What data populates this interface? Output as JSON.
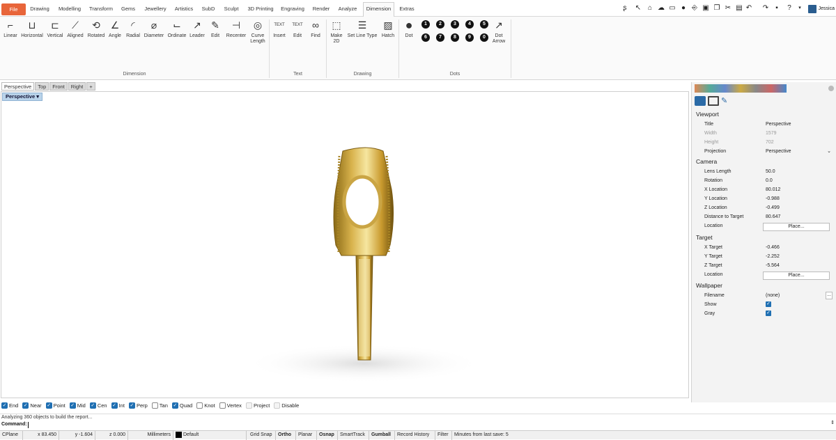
{
  "menubar": {
    "tabs": [
      "File",
      "Drawing",
      "Modelling",
      "Transform",
      "Gems",
      "Jewellery",
      "Artistics",
      "SubD",
      "Sculpt",
      "3D Printing",
      "Engraving",
      "Render",
      "Analyze",
      "Dimension",
      "Extras"
    ],
    "active_tab": "Dimension",
    "user": "Jessica"
  },
  "ribbon": {
    "dimension": {
      "group": "Dimension",
      "buttons": [
        "Linear",
        "Horizontal",
        "Vertical",
        "Aligned",
        "Rotated",
        "Angle",
        "Radial",
        "Diameter",
        "Ordinate",
        "Leader",
        "Edit",
        "Recenter",
        "Curve Length"
      ]
    },
    "text": {
      "group": "Text",
      "buttons": [
        "Insert",
        "Edit",
        "Find"
      ],
      "insert_glyph": "TEXT",
      "edit_glyph": "TEXT"
    },
    "drawing": {
      "group": "Drawing",
      "buttons": [
        "Make 2D",
        "Set Line Type",
        "Hatch"
      ]
    },
    "dots": {
      "group": "Dots",
      "dot_label": "Dot",
      "dot_arrow_label": "Dot Arrow",
      "numbers": [
        "1",
        "2",
        "3",
        "4",
        "5",
        "6",
        "7",
        "8",
        "9",
        "0"
      ]
    }
  },
  "viewport": {
    "tabs": [
      "Perspective",
      "Top",
      "Front",
      "Right"
    ],
    "active_label": "Perspective"
  },
  "panel": {
    "viewport_header": "Viewport",
    "title_k": "Title",
    "title_v": "Perspective",
    "width_k": "Width",
    "width_v": "1579",
    "height_k": "Height",
    "height_v": "702",
    "projection_k": "Projection",
    "projection_v": "Perspective",
    "camera_header": "Camera",
    "lens_k": "Lens Length",
    "lens_v": "50.0",
    "rot_k": "Rotation",
    "rot_v": "0.0",
    "xloc_k": "X Location",
    "xloc_v": "80.012",
    "yloc_k": "Y Location",
    "yloc_v": "-0.988",
    "zloc_k": "Z Location",
    "zloc_v": "-0.499",
    "dist_k": "Distance to Target",
    "dist_v": "80.647",
    "loc_k": "Location",
    "place_label": "Place...",
    "target_header": "Target",
    "xt_k": "X Target",
    "xt_v": "-0.466",
    "yt_k": "Y Target",
    "yt_v": "-2.252",
    "zt_k": "Z Target",
    "zt_v": "-5.564",
    "tloc_k": "Location",
    "wall_header": "Wallpaper",
    "file_k": "Filename",
    "file_v": "(none)",
    "file_btn": "...",
    "show_k": "Show",
    "gray_k": "Gray"
  },
  "osnap": [
    {
      "label": "End",
      "on": true
    },
    {
      "label": "Near",
      "on": true
    },
    {
      "label": "Point",
      "on": true
    },
    {
      "label": "Mid",
      "on": true
    },
    {
      "label": "Cen",
      "on": true
    },
    {
      "label": "Int",
      "on": true
    },
    {
      "label": "Perp",
      "on": true
    },
    {
      "label": "Tan",
      "on": false
    },
    {
      "label": "Quad",
      "on": true
    },
    {
      "label": "Knot",
      "on": false
    },
    {
      "label": "Vertex",
      "on": false
    },
    {
      "label": "Project",
      "on": false
    },
    {
      "label": "Disable",
      "on": false
    }
  ],
  "command": {
    "history": "Analyzing 360 objects to build the report...",
    "prompt": "Command:"
  },
  "status": {
    "cplane": "CPlane",
    "x": "x 83.450",
    "y": "y -1.604",
    "z": "z 0.000",
    "units": "Millimeters",
    "layer": "Default",
    "grid_snap": "Grid Snap",
    "ortho": "Ortho",
    "planar": "Planar",
    "osnap": "Osnap",
    "smarttrack": "SmartTrack",
    "gumball": "Gumball",
    "record": "Record History",
    "filter": "Filter",
    "save": "Minutes from last save: 5"
  }
}
